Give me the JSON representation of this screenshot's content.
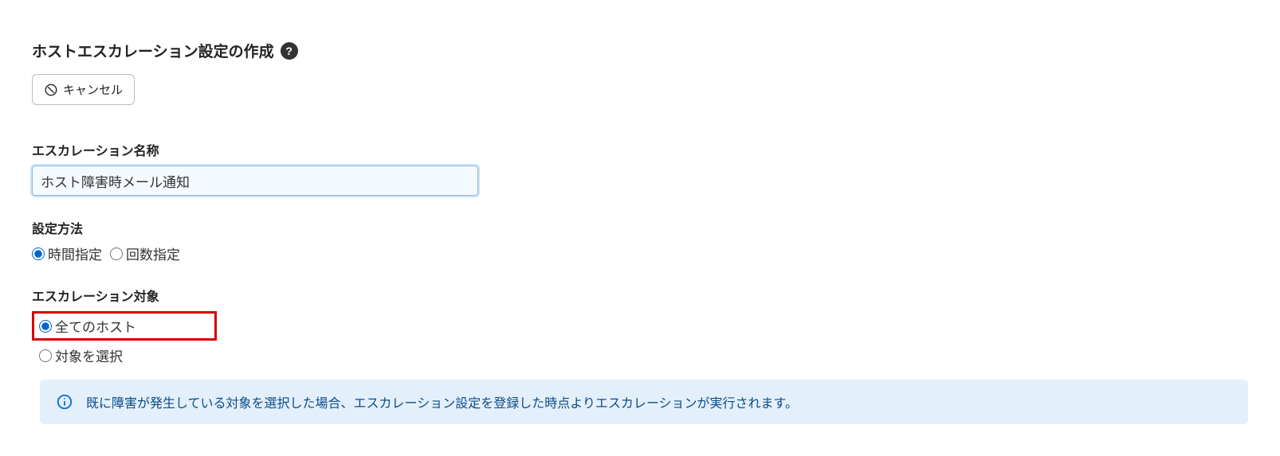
{
  "header": {
    "title": "ホストエスカレーション設定の作成"
  },
  "cancel": {
    "label": "キャンセル"
  },
  "form": {
    "name": {
      "label": "エスカレーション名称",
      "value": "ホスト障害時メール通知"
    },
    "method": {
      "label": "設定方法",
      "options": {
        "time": "時間指定",
        "count": "回数指定"
      }
    },
    "target": {
      "label": "エスカレーション対象",
      "options": {
        "all": "全てのホスト",
        "select": "対象を選択"
      }
    }
  },
  "info": {
    "message": "既に障害が発生している対象を選択した場合、エスカレーション設定を登録した時点よりエスカレーションが実行されます。"
  }
}
